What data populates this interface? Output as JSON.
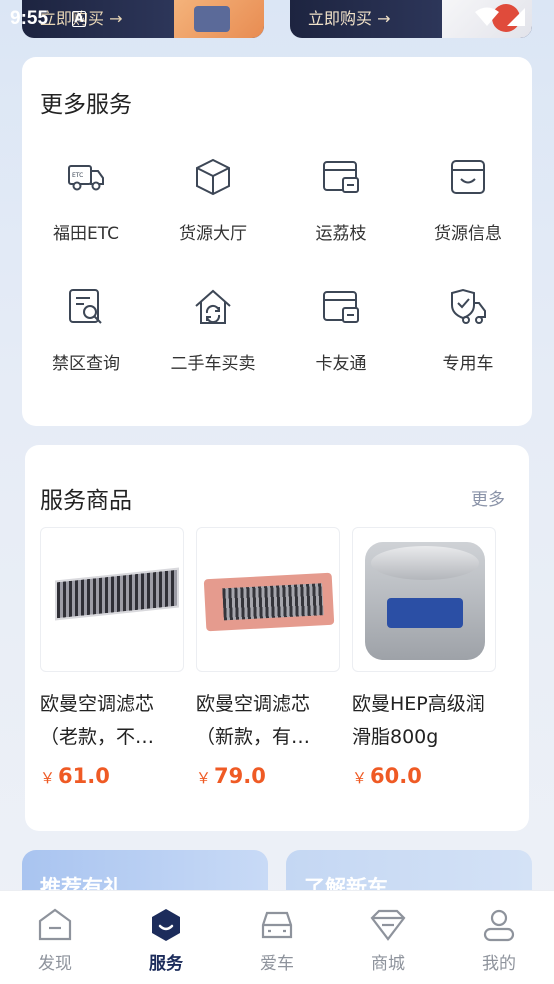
{
  "status_bar": {
    "time": "9:55",
    "notif_badge": "A"
  },
  "banners": [
    {
      "label": "立即购买 →"
    },
    {
      "label": "立即购买 →"
    }
  ],
  "services": {
    "title": "更多服务",
    "items": [
      {
        "label": "福田ETC",
        "icon": "etc-truck-icon"
      },
      {
        "label": "货源大厅",
        "icon": "cube-icon"
      },
      {
        "label": "运荔枝",
        "icon": "card-window-icon"
      },
      {
        "label": "货源信息",
        "icon": "shop-icon"
      },
      {
        "label": "禁区查询",
        "icon": "doc-search-icon"
      },
      {
        "label": "二手车买卖",
        "icon": "house-refresh-icon"
      },
      {
        "label": "卡友通",
        "icon": "card-window-icon"
      },
      {
        "label": "专用车",
        "icon": "shield-truck-icon"
      }
    ]
  },
  "goods": {
    "title": "服务商品",
    "more": "更多",
    "products": [
      {
        "name": "欧曼空调滤芯（老款，不…",
        "currency": "￥",
        "price": "61.0"
      },
      {
        "name": "欧曼空调滤芯（新款，有…",
        "currency": "￥",
        "price": "79.0"
      },
      {
        "name": "欧曼HEP高级润滑脂800g",
        "currency": "￥",
        "price": "60.0"
      }
    ]
  },
  "promos": [
    {
      "label": "推荐有礼"
    },
    {
      "label": "了解新车"
    }
  ],
  "tabbar": {
    "tabs": [
      {
        "label": "发现",
        "icon": "discover-icon",
        "active": false
      },
      {
        "label": "服务",
        "icon": "service-icon",
        "active": true
      },
      {
        "label": "爱车",
        "icon": "car-icon",
        "active": false
      },
      {
        "label": "商城",
        "icon": "diamond-icon",
        "active": false
      },
      {
        "label": "我的",
        "icon": "user-icon",
        "active": false
      }
    ]
  },
  "colors": {
    "accent": "#1c2c5b",
    "price": "#ef5a24",
    "icon_stroke": "#3d4756",
    "inactive_tab": "#8e939c"
  }
}
